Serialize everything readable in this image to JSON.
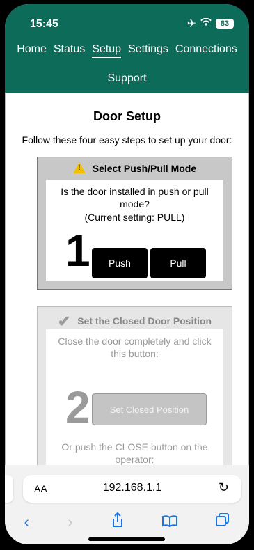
{
  "status_bar": {
    "time": "15:45",
    "battery": "83",
    "icons": [
      "airplane-icon",
      "wifi-icon",
      "battery-icon"
    ]
  },
  "nav": {
    "items": [
      {
        "label": "Home"
      },
      {
        "label": "Status"
      },
      {
        "label": "Setup",
        "active": true
      },
      {
        "label": "Settings"
      },
      {
        "label": "Connections"
      }
    ],
    "row2": [
      {
        "label": "Support"
      }
    ]
  },
  "page": {
    "title": "Door Setup",
    "intro": "Follow these four easy steps to set up your door:"
  },
  "step1": {
    "title": "Select Push/Pull Mode",
    "question": "Is the door installed in push or pull mode?",
    "current": "(Current setting: PULL)",
    "number": "1",
    "push_label": "Push",
    "pull_label": "Pull"
  },
  "step2": {
    "title": "Set the Closed Door Position",
    "description": "Close the door completely and click this button:",
    "number": "2",
    "button_label": "Set Closed Position",
    "alt_instruction": "Or push the CLOSE button on the operator:"
  },
  "browser": {
    "text_size_label": "AA",
    "url": "192.168.1.1"
  },
  "colors": {
    "header_bg": "#0d6b5a",
    "accent": "#1a73e8"
  }
}
